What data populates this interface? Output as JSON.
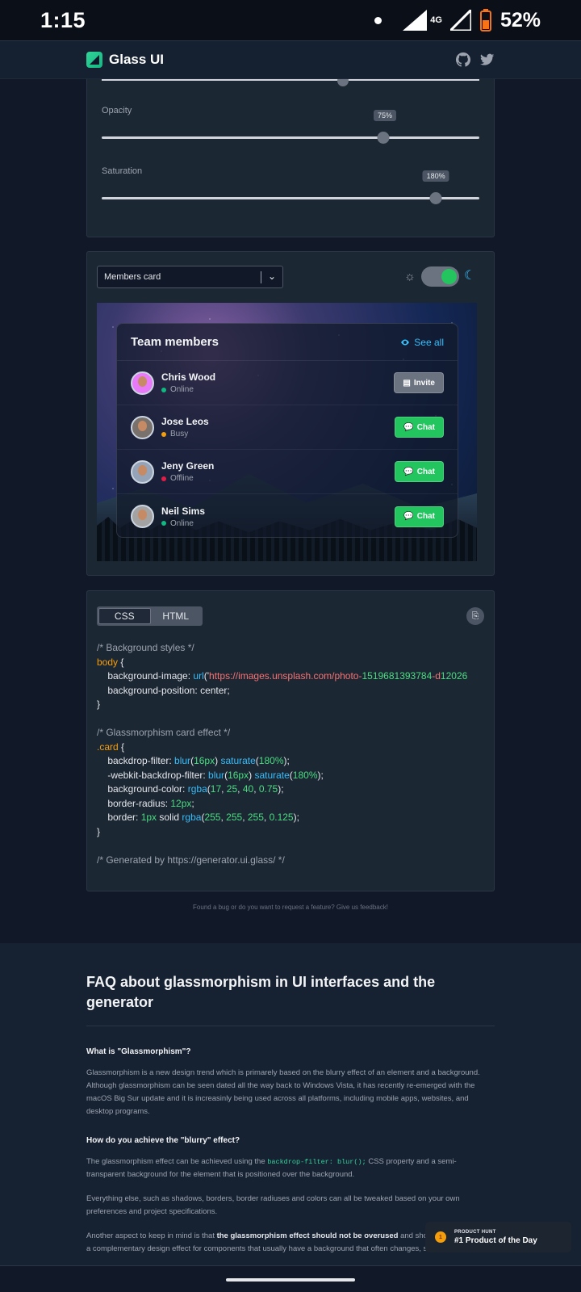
{
  "status": {
    "time": "1:15",
    "network": "4G",
    "battery": "52%"
  },
  "nav": {
    "app_name": "Glass UI"
  },
  "sliders": [
    {
      "label": "Opacity",
      "value": "75%",
      "level": 0.75
    },
    {
      "label": "Saturation",
      "value": "180%",
      "level": 0.9
    }
  ],
  "preview": {
    "select_value": "Members card",
    "card": {
      "title": "Team members",
      "see_all": "See all",
      "members": [
        {
          "name": "Chris Wood",
          "status": "Online",
          "status_color": "#10b981",
          "button": "Invite",
          "button_icon": "clipboard-icon",
          "button_color": "#6b7280"
        },
        {
          "name": "Jose Leos",
          "status": "Busy",
          "status_color": "#f59e0b",
          "button": "Chat",
          "button_icon": "chat-icon",
          "button_color": "#22c55e"
        },
        {
          "name": "Jeny Green",
          "status": "Offline",
          "status_color": "#e11d48",
          "button": "Chat",
          "button_icon": "chat-icon",
          "button_color": "#22c55e"
        },
        {
          "name": "Neil Sims",
          "status": "Online",
          "status_color": "#10b981",
          "button": "Chat",
          "button_icon": "chat-icon",
          "button_color": "#22c55e"
        }
      ]
    }
  },
  "code": {
    "tabs": [
      "CSS",
      "HTML"
    ],
    "lines": [
      "/* Background styles */",
      "body {",
      "    background-image: url('https://images.unsplash.com/photo-1519681393784-d12026",
      "    background-position: center;",
      "}",
      "",
      "/* Glassmorphism card effect */",
      ".card {",
      "    backdrop-filter: blur(16px) saturate(180%);",
      "    -webkit-backdrop-filter: blur(16px) saturate(180%);",
      "    background-color: rgba(17, 25, 40, 0.75);",
      "    border-radius: 12px;",
      "    border: 1px solid rgba(255, 255, 255, 0.125);",
      "}",
      "",
      "/* Generated by https://generator.ui.glass/ */"
    ]
  },
  "feedback": "Found a bug or do you want to request a feature? Give us feedback!",
  "faq": {
    "title": "FAQ about glassmorphism in UI interfaces and the generator",
    "q1": "What is \"Glassmorphism\"?",
    "a1": "Glassmorphism is a new design trend which is primarely based on the blurry effect of an element and a background. Although glassmorphism can be seen dated all the way back to Windows Vista, it has recently re-emerged with the macOS Big Sur update and it is increasinly being used across all platforms, including mobile apps, websites, and desktop programs.",
    "q2": "How do you achieve the \"blurry\" effect?",
    "a2_pre": "The glassmorphism effect can be achieved using the ",
    "a2_code": "backdrop-filter: blur();",
    "a2_post": " CSS property and a semi-transparent background for the element that is positioned over the background.",
    "a3": "Everything else, such as shadows, borders, border radiuses and colors can all be tweaked based on your own preferences and project specifications.",
    "a4_pre": "Another aspect to keep in mind is that ",
    "a4_bold": "the glassmorphism effect should not be overused",
    "a4_post": " and should only be used as a complementary design effect for components that usually have a background that often changes, such as"
  },
  "product_hunt": {
    "kicker": "PRODUCT HUNT",
    "title": "#1 Product of the Day",
    "rank": "1"
  }
}
